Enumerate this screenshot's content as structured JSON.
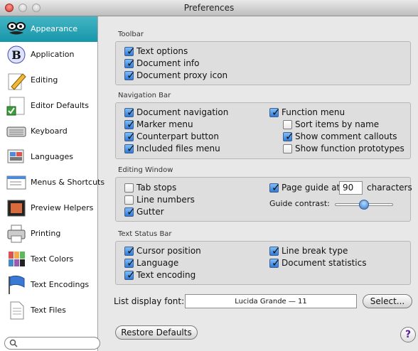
{
  "window": {
    "title": "Preferences"
  },
  "sidebar": {
    "items": [
      {
        "label": "Appearance",
        "icon": "glasses-mustache-icon",
        "selected": true
      },
      {
        "label": "Application",
        "icon": "application-b-icon"
      },
      {
        "label": "Editing",
        "icon": "pencil-paper-icon"
      },
      {
        "label": "Editor Defaults",
        "icon": "editor-defaults-icon"
      },
      {
        "label": "Keyboard",
        "icon": "keyboard-icon"
      },
      {
        "label": "Languages",
        "icon": "languages-icon"
      },
      {
        "label": "Menus & Shortcuts",
        "icon": "menus-icon"
      },
      {
        "label": "Preview Helpers",
        "icon": "preview-icon"
      },
      {
        "label": "Printing",
        "icon": "printer-icon"
      },
      {
        "label": "Text Colors",
        "icon": "color-palette-icon"
      },
      {
        "label": "Text Encodings",
        "icon": "flag-icon"
      },
      {
        "label": "Text Files",
        "icon": "document-icon"
      }
    ],
    "search": {
      "placeholder": ""
    }
  },
  "toolbar_section": {
    "title": "Toolbar",
    "options": [
      {
        "label": "Text options",
        "checked": true
      },
      {
        "label": "Document info",
        "checked": true
      },
      {
        "label": "Document proxy icon",
        "checked": true
      }
    ]
  },
  "navigation_bar": {
    "title": "Navigation Bar",
    "left": [
      {
        "label": "Document navigation",
        "checked": true
      },
      {
        "label": "Marker menu",
        "checked": true
      },
      {
        "label": "Counterpart button",
        "checked": true
      },
      {
        "label": "Included files menu",
        "checked": true
      }
    ],
    "right": [
      {
        "label": "Function menu",
        "checked": true
      },
      {
        "label": "Sort items by name",
        "checked": false
      },
      {
        "label": "Show comment callouts",
        "checked": true
      },
      {
        "label": "Show function prototypes",
        "checked": false
      }
    ]
  },
  "editing_window": {
    "title": "Editing Window",
    "left": [
      {
        "label": "Tab stops",
        "checked": false
      },
      {
        "label": "Line numbers",
        "checked": false
      },
      {
        "label": "Gutter",
        "checked": true
      }
    ],
    "page_guide": {
      "label": "Page guide at",
      "checked": true,
      "value": "90",
      "suffix": "characters"
    },
    "guide_contrast": {
      "label": "Guide contrast:",
      "level": 0.5
    }
  },
  "text_status_bar": {
    "title": "Text Status Bar",
    "left": [
      {
        "label": "Cursor position",
        "checked": true
      },
      {
        "label": "Language",
        "checked": true
      },
      {
        "label": "Text encoding",
        "checked": true
      }
    ],
    "right": [
      {
        "label": "Line break type",
        "checked": true
      },
      {
        "label": "Document statistics",
        "checked": true
      }
    ]
  },
  "list_font": {
    "label": "List display font:",
    "value": "Lucida Grande — 11",
    "button": "Select..."
  },
  "footer": {
    "restore": "Restore Defaults",
    "help": "?"
  },
  "colors": {
    "accent": "#1796aa",
    "checkbox": "#2f7ad7"
  }
}
